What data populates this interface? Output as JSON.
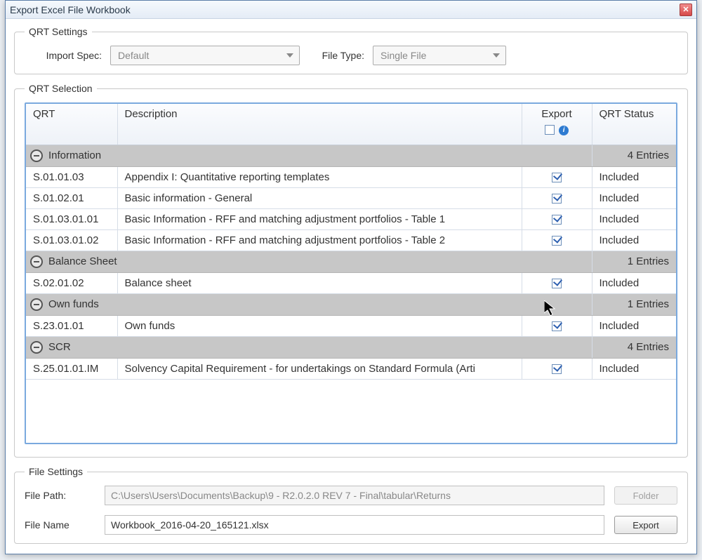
{
  "window": {
    "title": "Export Excel File Workbook"
  },
  "qrt_settings": {
    "legend": "QRT Settings",
    "import_spec_label": "Import Spec:",
    "import_spec_value": "Default",
    "file_type_label": "File Type:",
    "file_type_value": "Single File"
  },
  "qrt_selection": {
    "legend": "QRT Selection",
    "columns": {
      "qrt": "QRT",
      "description": "Description",
      "export": "Export",
      "status": "QRT Status"
    },
    "entries_word": "Entries",
    "groups": [
      {
        "name": "Information",
        "count": 4,
        "rows": [
          {
            "qrt": "S.01.01.03",
            "desc": "Appendix I: Quantitative reporting templates",
            "export": true,
            "status": "Included"
          },
          {
            "qrt": "S.01.02.01",
            "desc": "Basic information - General",
            "export": true,
            "status": "Included"
          },
          {
            "qrt": "S.01.03.01.01",
            "desc": "Basic Information - RFF and matching adjustment portfolios - Table 1",
            "export": true,
            "status": "Included"
          },
          {
            "qrt": "S.01.03.01.02",
            "desc": "Basic Information - RFF and matching adjustment portfolios - Table 2",
            "export": true,
            "status": "Included"
          }
        ]
      },
      {
        "name": "Balance Sheet",
        "count": 1,
        "rows": [
          {
            "qrt": "S.02.01.02",
            "desc": "Balance sheet",
            "export": true,
            "status": "Included"
          }
        ]
      },
      {
        "name": "Own funds",
        "count": 1,
        "rows": [
          {
            "qrt": "S.23.01.01",
            "desc": "Own funds",
            "export": true,
            "status": "Included"
          }
        ]
      },
      {
        "name": "SCR",
        "count": 4,
        "rows": [
          {
            "qrt": "S.25.01.01.IM",
            "desc": "Solvency Capital Requirement - for undertakings on Standard Formula (Arti",
            "export": true,
            "status": "Included"
          }
        ]
      }
    ]
  },
  "file_settings": {
    "legend": "File Settings",
    "file_path_label": "File Path:",
    "file_path_value": "C:\\Users\\Users\\Documents\\Backup\\9 - R2.0.2.0 REV 7 - Final\\tabular\\Returns",
    "file_name_label": "File Name",
    "file_name_value": "Workbook_2016-04-20_165121.xlsx",
    "folder_button": "Folder",
    "export_button": "Export"
  }
}
